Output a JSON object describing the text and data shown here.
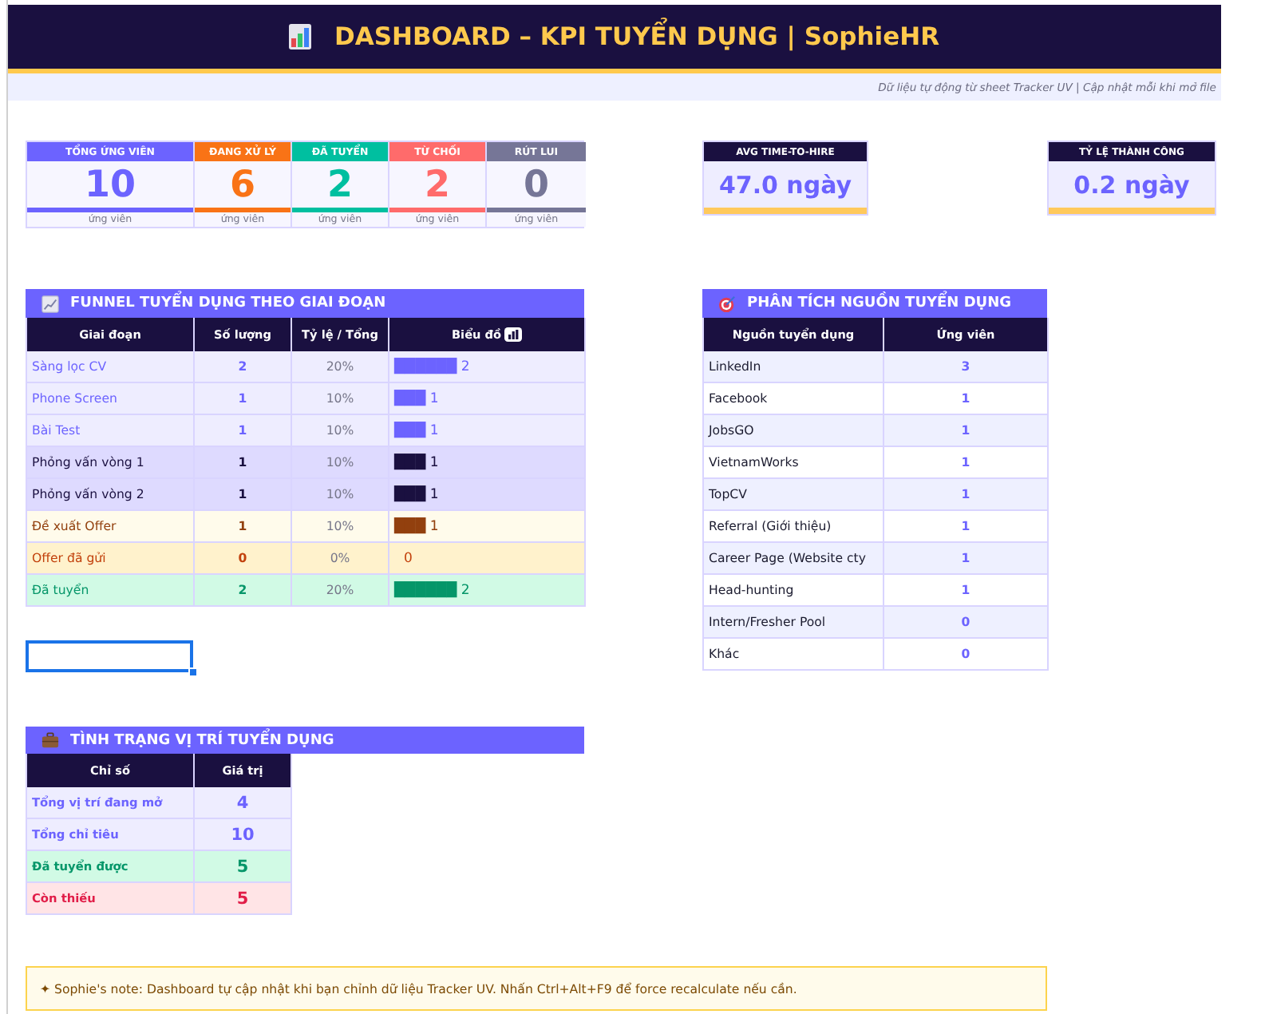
{
  "header": {
    "title": "DASHBOARD – KPI TUYỂN DỤNG | SophieHR",
    "subtitle": "Dữ liệu tự động từ sheet Tracker UV | Cập nhật mỗi khi mở file"
  },
  "kpi_cards": [
    {
      "label": "TỔNG ỨNG VIÊN",
      "value": "10",
      "unit": "ứng viên",
      "color": "#6c63ff"
    },
    {
      "label": "ĐANG XỬ LÝ",
      "value": "6",
      "unit": "ứng viên",
      "color": "#f97316"
    },
    {
      "label": "ĐÃ TUYỂN",
      "value": "2",
      "unit": "ứng viên",
      "color": "#00bfa0"
    },
    {
      "label": "TỪ CHỐI",
      "value": "2",
      "unit": "ứng viên",
      "color": "#ff6b6b"
    },
    {
      "label": "RÚT LUI",
      "value": "0",
      "unit": "ứng viên",
      "color": "#767697"
    }
  ],
  "metric_cards": [
    {
      "label": "AVG TIME-TO-HIRE",
      "value": "47.0 ngày"
    },
    {
      "label": "TỶ LỆ THÀNH CÔNG",
      "value": "0.2 ngày"
    }
  ],
  "funnel": {
    "title": "FUNNEL TUYỂN DỤNG THEO GIAI ĐOẠN",
    "columns": [
      "Giai đoạn",
      "Số lượng",
      "Tỷ lệ / Tổng",
      "Biểu đồ"
    ],
    "rows": [
      {
        "kind": "early",
        "stage": "Sàng lọc CV",
        "count": "2",
        "ratio": "20%",
        "chart": "██████ 2"
      },
      {
        "kind": "early",
        "stage": "Phone Screen",
        "count": "1",
        "ratio": "10%",
        "chart": "███ 1"
      },
      {
        "kind": "early",
        "stage": "Bài Test",
        "count": "1",
        "ratio": "10%",
        "chart": "███ 1"
      },
      {
        "kind": "interview",
        "stage": "Phỏng vấn vòng 1",
        "count": "1",
        "ratio": "10%",
        "chart": "███ 1"
      },
      {
        "kind": "interview",
        "stage": "Phỏng vấn vòng 2",
        "count": "1",
        "ratio": "10%",
        "chart": "███ 1"
      },
      {
        "kind": "offer",
        "stage": "Đề xuất Offer",
        "count": "1",
        "ratio": "10%",
        "chart": "███ 1"
      },
      {
        "kind": "sent",
        "stage": "Offer đã gửi",
        "count": "0",
        "ratio": "0%",
        "chart": "0"
      },
      {
        "kind": "hired",
        "stage": "Đã tuyển",
        "count": "2",
        "ratio": "20%",
        "chart": "██████ 2"
      }
    ]
  },
  "active_cell": {
    "selected": true
  },
  "sources": {
    "title": "PHÂN TÍCH NGUỒN TUYỂN DỤNG",
    "columns": [
      "Nguồn tuyển dụng",
      "Ứng viên"
    ],
    "rows": [
      {
        "source": "LinkedIn",
        "candidates": "3"
      },
      {
        "source": "Facebook",
        "candidates": "1"
      },
      {
        "source": "JobsGO",
        "candidates": "1"
      },
      {
        "source": "VietnamWorks",
        "candidates": "1"
      },
      {
        "source": "TopCV",
        "candidates": "1"
      },
      {
        "source": "Referral (Giới thiệu)",
        "candidates": "1"
      },
      {
        "source": "Career Page (Website cty",
        "candidates": "1"
      },
      {
        "source": "Head-hunting",
        "candidates": "1"
      },
      {
        "source": "Intern/Fresher Pool",
        "candidates": "0"
      },
      {
        "source": "Khác",
        "candidates": "0"
      }
    ]
  },
  "positions": {
    "title": "TÌNH TRẠNG VỊ TRÍ TUYỂN DỤNG",
    "columns": [
      "Chỉ số",
      "Giá trị"
    ],
    "rows": [
      {
        "kind": "info",
        "metric": "Tổng vị trí đang mở",
        "value": "4"
      },
      {
        "kind": "info",
        "metric": "Tổng chỉ tiêu",
        "value": "10"
      },
      {
        "kind": "success",
        "metric": "Đã tuyển được",
        "value": "5"
      },
      {
        "kind": "danger",
        "metric": "Còn thiếu",
        "value": "5"
      }
    ]
  },
  "note": {
    "text": "✦ Sophie's note: Dashboard tự cập nhật khi bạn chỉnh dữ liệu Tracker UV. Nhấn Ctrl+Alt+F9 để force recalculate nếu cần."
  }
}
